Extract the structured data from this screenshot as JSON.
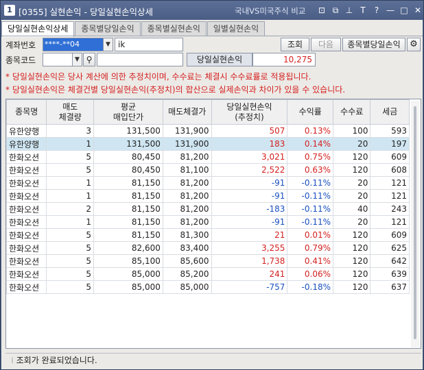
{
  "window": {
    "app_number": "1",
    "title": "[0355] 실현손익 - 당일실현손익상세",
    "compare_link": "국내VS미국주식 비교",
    "title_icons": [
      "pin-icon",
      "restore-window-icon",
      "bookmark-icon",
      "text-size-icon",
      "help-icon",
      "minimize-icon",
      "maximize-icon",
      "close-icon"
    ],
    "title_icon_glyphs": [
      "⊡",
      "⧉",
      "⊥",
      "T",
      "?",
      "—",
      "□",
      "✕"
    ]
  },
  "tabs": [
    {
      "label": "당일실현손익상세",
      "active": true
    },
    {
      "label": "종목별당일손익",
      "active": false
    },
    {
      "label": "종목별실현손익",
      "active": false
    },
    {
      "label": "일별실현손익",
      "active": false
    }
  ],
  "form": {
    "account_label": "계좌번호",
    "account_value": "****-**04",
    "account_name": "ik",
    "stock_label": "종목코드",
    "stock_value": "",
    "stock_name": "",
    "query_button": "조회",
    "next_button": "다음",
    "by_stock_button": "종목별당일손익",
    "pnl_label": "당일실현손익",
    "pnl_value": "10,275"
  },
  "notes": [
    "* 당일실현손익은 당사 계산에 의한 추정치이며, 수수료는 체결시 수수료률로 적용됩니다.",
    "* 당일실현손익은 체결건별 당일실현손익(추정치)의 합산으로 실제손익과 차이가 있을 수 있습니다."
  ],
  "table": {
    "headers": [
      "종목명",
      "매도\n체결량",
      "평균\n매입단가",
      "매도체결가",
      "당일실현손익\n(추정치)",
      "수익률",
      "수수료",
      "세금"
    ],
    "rows": [
      [
        "유한양행",
        "3",
        "131,500",
        "131,900",
        "507",
        "0.13%",
        "100",
        "593"
      ],
      [
        "유한양행",
        "1",
        "131,500",
        "131,900",
        "183",
        "0.14%",
        "20",
        "197"
      ],
      [
        "한화오션",
        "5",
        "80,450",
        "81,200",
        "3,021",
        "0.75%",
        "120",
        "609"
      ],
      [
        "한화오션",
        "5",
        "80,450",
        "81,100",
        "2,522",
        "0.63%",
        "120",
        "608"
      ],
      [
        "한화오션",
        "1",
        "81,150",
        "81,200",
        "-91",
        "-0.11%",
        "20",
        "121"
      ],
      [
        "한화오션",
        "1",
        "81,150",
        "81,200",
        "-91",
        "-0.11%",
        "20",
        "121"
      ],
      [
        "한화오션",
        "2",
        "81,150",
        "81,200",
        "-183",
        "-0.11%",
        "40",
        "243"
      ],
      [
        "한화오션",
        "1",
        "81,150",
        "81,200",
        "-91",
        "-0.11%",
        "20",
        "121"
      ],
      [
        "한화오션",
        "5",
        "81,150",
        "81,300",
        "21",
        "0.01%",
        "120",
        "609"
      ],
      [
        "한화오션",
        "5",
        "82,600",
        "83,400",
        "3,255",
        "0.79%",
        "120",
        "625"
      ],
      [
        "한화오션",
        "5",
        "85,100",
        "85,600",
        "1,738",
        "0.41%",
        "120",
        "642"
      ],
      [
        "한화오션",
        "5",
        "85,000",
        "85,200",
        "241",
        "0.06%",
        "120",
        "639"
      ],
      [
        "한화오션",
        "5",
        "85,000",
        "85,000",
        "-757",
        "-0.18%",
        "120",
        "637"
      ]
    ],
    "selected_row": 1,
    "empty_rows": 4
  },
  "status": {
    "message": "조회가 완료되었습니다."
  },
  "colors": {
    "positive": "#d42020",
    "negative": "#1a4fbf",
    "selection": "#cfe6f2",
    "account_highlight": "#2f6fd6"
  }
}
